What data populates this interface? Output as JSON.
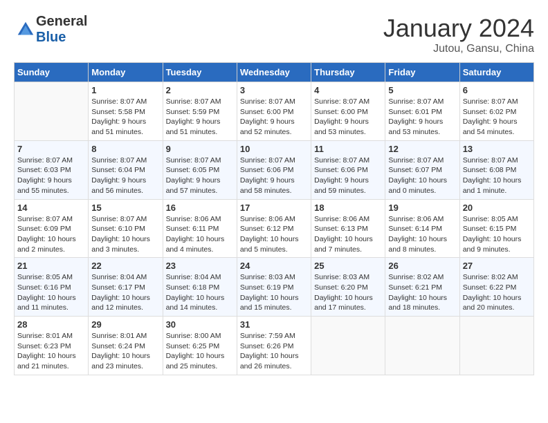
{
  "header": {
    "logo": {
      "general": "General",
      "blue": "Blue"
    },
    "month": "January 2024",
    "location": "Jutou, Gansu, China"
  },
  "weekdays": [
    "Sunday",
    "Monday",
    "Tuesday",
    "Wednesday",
    "Thursday",
    "Friday",
    "Saturday"
  ],
  "weeks": [
    [
      {
        "day": "",
        "info": ""
      },
      {
        "day": "1",
        "info": "Sunrise: 8:07 AM\nSunset: 5:58 PM\nDaylight: 9 hours\nand 51 minutes."
      },
      {
        "day": "2",
        "info": "Sunrise: 8:07 AM\nSunset: 5:59 PM\nDaylight: 9 hours\nand 51 minutes."
      },
      {
        "day": "3",
        "info": "Sunrise: 8:07 AM\nSunset: 6:00 PM\nDaylight: 9 hours\nand 52 minutes."
      },
      {
        "day": "4",
        "info": "Sunrise: 8:07 AM\nSunset: 6:00 PM\nDaylight: 9 hours\nand 53 minutes."
      },
      {
        "day": "5",
        "info": "Sunrise: 8:07 AM\nSunset: 6:01 PM\nDaylight: 9 hours\nand 53 minutes."
      },
      {
        "day": "6",
        "info": "Sunrise: 8:07 AM\nSunset: 6:02 PM\nDaylight: 9 hours\nand 54 minutes."
      }
    ],
    [
      {
        "day": "7",
        "info": "Sunrise: 8:07 AM\nSunset: 6:03 PM\nDaylight: 9 hours\nand 55 minutes."
      },
      {
        "day": "8",
        "info": "Sunrise: 8:07 AM\nSunset: 6:04 PM\nDaylight: 9 hours\nand 56 minutes."
      },
      {
        "day": "9",
        "info": "Sunrise: 8:07 AM\nSunset: 6:05 PM\nDaylight: 9 hours\nand 57 minutes."
      },
      {
        "day": "10",
        "info": "Sunrise: 8:07 AM\nSunset: 6:06 PM\nDaylight: 9 hours\nand 58 minutes."
      },
      {
        "day": "11",
        "info": "Sunrise: 8:07 AM\nSunset: 6:06 PM\nDaylight: 9 hours\nand 59 minutes."
      },
      {
        "day": "12",
        "info": "Sunrise: 8:07 AM\nSunset: 6:07 PM\nDaylight: 10 hours\nand 0 minutes."
      },
      {
        "day": "13",
        "info": "Sunrise: 8:07 AM\nSunset: 6:08 PM\nDaylight: 10 hours\nand 1 minute."
      }
    ],
    [
      {
        "day": "14",
        "info": "Sunrise: 8:07 AM\nSunset: 6:09 PM\nDaylight: 10 hours\nand 2 minutes."
      },
      {
        "day": "15",
        "info": "Sunrise: 8:07 AM\nSunset: 6:10 PM\nDaylight: 10 hours\nand 3 minutes."
      },
      {
        "day": "16",
        "info": "Sunrise: 8:06 AM\nSunset: 6:11 PM\nDaylight: 10 hours\nand 4 minutes."
      },
      {
        "day": "17",
        "info": "Sunrise: 8:06 AM\nSunset: 6:12 PM\nDaylight: 10 hours\nand 5 minutes."
      },
      {
        "day": "18",
        "info": "Sunrise: 8:06 AM\nSunset: 6:13 PM\nDaylight: 10 hours\nand 7 minutes."
      },
      {
        "day": "19",
        "info": "Sunrise: 8:06 AM\nSunset: 6:14 PM\nDaylight: 10 hours\nand 8 minutes."
      },
      {
        "day": "20",
        "info": "Sunrise: 8:05 AM\nSunset: 6:15 PM\nDaylight: 10 hours\nand 9 minutes."
      }
    ],
    [
      {
        "day": "21",
        "info": "Sunrise: 8:05 AM\nSunset: 6:16 PM\nDaylight: 10 hours\nand 11 minutes."
      },
      {
        "day": "22",
        "info": "Sunrise: 8:04 AM\nSunset: 6:17 PM\nDaylight: 10 hours\nand 12 minutes."
      },
      {
        "day": "23",
        "info": "Sunrise: 8:04 AM\nSunset: 6:18 PM\nDaylight: 10 hours\nand 14 minutes."
      },
      {
        "day": "24",
        "info": "Sunrise: 8:03 AM\nSunset: 6:19 PM\nDaylight: 10 hours\nand 15 minutes."
      },
      {
        "day": "25",
        "info": "Sunrise: 8:03 AM\nSunset: 6:20 PM\nDaylight: 10 hours\nand 17 minutes."
      },
      {
        "day": "26",
        "info": "Sunrise: 8:02 AM\nSunset: 6:21 PM\nDaylight: 10 hours\nand 18 minutes."
      },
      {
        "day": "27",
        "info": "Sunrise: 8:02 AM\nSunset: 6:22 PM\nDaylight: 10 hours\nand 20 minutes."
      }
    ],
    [
      {
        "day": "28",
        "info": "Sunrise: 8:01 AM\nSunset: 6:23 PM\nDaylight: 10 hours\nand 21 minutes."
      },
      {
        "day": "29",
        "info": "Sunrise: 8:01 AM\nSunset: 6:24 PM\nDaylight: 10 hours\nand 23 minutes."
      },
      {
        "day": "30",
        "info": "Sunrise: 8:00 AM\nSunset: 6:25 PM\nDaylight: 10 hours\nand 25 minutes."
      },
      {
        "day": "31",
        "info": "Sunrise: 7:59 AM\nSunset: 6:26 PM\nDaylight: 10 hours\nand 26 minutes."
      },
      {
        "day": "",
        "info": ""
      },
      {
        "day": "",
        "info": ""
      },
      {
        "day": "",
        "info": ""
      }
    ]
  ]
}
